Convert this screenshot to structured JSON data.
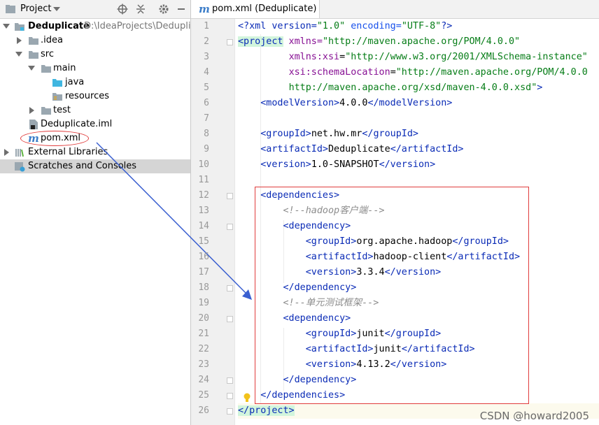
{
  "project_panel": {
    "title": "Project",
    "tree": [
      {
        "label": "Deduplicate",
        "path": "D:\\IdeaProjects\\Deduplicat",
        "icon": "module-folder-icon",
        "expanded": true
      },
      {
        "label": ".idea",
        "icon": "folder-icon",
        "expanded": false
      },
      {
        "label": "src",
        "icon": "folder-icon",
        "expanded": true
      },
      {
        "label": "main",
        "icon": "folder-icon",
        "expanded": true
      },
      {
        "label": "java",
        "icon": "source-folder-icon"
      },
      {
        "label": "resources",
        "icon": "resources-folder-icon"
      },
      {
        "label": "test",
        "icon": "folder-icon",
        "expanded": false
      },
      {
        "label": "Deduplicate.iml",
        "icon": "iml-file-icon"
      },
      {
        "label": "pom.xml",
        "icon": "maven-file-icon"
      },
      {
        "label": "External Libraries",
        "icon": "libraries-icon",
        "expanded": false
      },
      {
        "label": "Scratches and Consoles",
        "icon": "scratches-icon",
        "selected": true
      }
    ]
  },
  "editor": {
    "tab_label": "pom.xml (Deduplicate)",
    "tab_icon": "m",
    "line_numbers": [
      "1",
      "2",
      "3",
      "4",
      "5",
      "6",
      "7",
      "8",
      "9",
      "10",
      "11",
      "12",
      "13",
      "14",
      "15",
      "16",
      "17",
      "18",
      "19",
      "20",
      "21",
      "22",
      "23",
      "24",
      "25",
      "26"
    ],
    "code": {
      "l1_a": "<?xml version=",
      "l1_b": "\"1.0\"",
      "l1_c": " encoding=",
      "l1_d": "\"UTF-8\"",
      "l1_e": "?>",
      "l2_tag": "<project",
      "l2_attr": " xmlns=",
      "l2_val": "\"http://maven.apache.org/POM/4.0.0\"",
      "l3_attr": "xmlns:xsi",
      "l3_eq": "=",
      "l3_val": "\"http://www.w3.org/2001/XMLSchema-instance\"",
      "l4_attr": "xsi:schemaLocation",
      "l4_eq": "=",
      "l4_val": "\"http://maven.apache.org/POM/4.0.0",
      "l5_val": "http://maven.apache.org/xsd/maven-4.0.0.xsd\"",
      "l5_end": ">",
      "l6_open": "<modelVersion>",
      "l6_text": "4.0.0",
      "l6_close": "</modelVersion>",
      "l8_open": "<groupId>",
      "l8_text": "net.hw.mr",
      "l8_close": "</groupId>",
      "l9_open": "<artifactId>",
      "l9_text": "Deduplicate",
      "l9_close": "</artifactId>",
      "l10_open": "<version>",
      "l10_text": "1.0-SNAPSHOT",
      "l10_close": "</version>",
      "l12": "<dependencies>",
      "l13": "<!--hadoop客户端-->",
      "l14": "<dependency>",
      "l15_open": "<groupId>",
      "l15_text": "org.apache.hadoop",
      "l15_close": "</groupId>",
      "l16_open": "<artifactId>",
      "l16_text": "hadoop-client",
      "l16_close": "</artifactId>",
      "l17_open": "<version>",
      "l17_text": "3.3.4",
      "l17_close": "</version>",
      "l18": "</dependency>",
      "l19": "<!--单元测试框架-->",
      "l20": "<dependency>",
      "l21_open": "<groupId>",
      "l21_text": "junit",
      "l21_close": "</groupId>",
      "l22_open": "<artifactId>",
      "l22_text": "junit",
      "l22_close": "</artifactId>",
      "l23_open": "<version>",
      "l23_text": "4.13.2",
      "l23_close": "</version>",
      "l24": "</dependency>",
      "l25": "</dependencies>",
      "l26": "</project>"
    }
  },
  "watermark": "CSDN @howard2005",
  "colors": {
    "annotation": "#e03c3c",
    "pointer_arrow": "#3a5fd0",
    "tag": "#0a2bb6",
    "string": "#067d17"
  }
}
